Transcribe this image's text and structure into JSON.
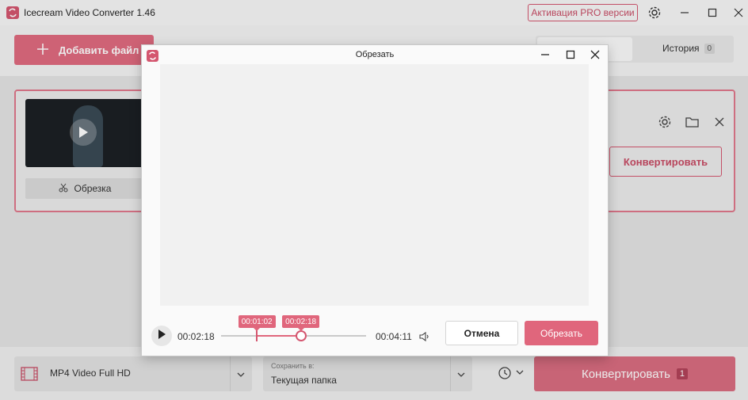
{
  "app": {
    "title": "Icecream Video Converter 1.46",
    "pro_button": "Активация PRO версии",
    "accent_color": "#d4566f"
  },
  "toolbar": {
    "add_file_label": "Добавить файл",
    "tabs": [
      {
        "label": "",
        "active": true
      },
      {
        "label": "История",
        "count": "0",
        "active": false
      }
    ]
  },
  "file_card": {
    "trim_label": "Обрезка",
    "convert_label": "Конвертировать",
    "icons": [
      "settings-icon",
      "folder-icon",
      "close-icon"
    ]
  },
  "bottombar": {
    "format_label": "MP4 Video Full HD",
    "save_caption": "Сохранить в:",
    "save_value": "Текущая папка",
    "convert_label": "Конвертировать",
    "convert_count": "1"
  },
  "dialog": {
    "title": "Обрезать",
    "current_time": "00:02:18",
    "total_time": "00:04:11",
    "start_tooltip": "00:01:02",
    "end_tooltip": "00:02:18",
    "start_fraction": 0.247,
    "end_fraction": 0.55,
    "cancel_label": "Отмена",
    "trim_label": "Обрезать"
  }
}
